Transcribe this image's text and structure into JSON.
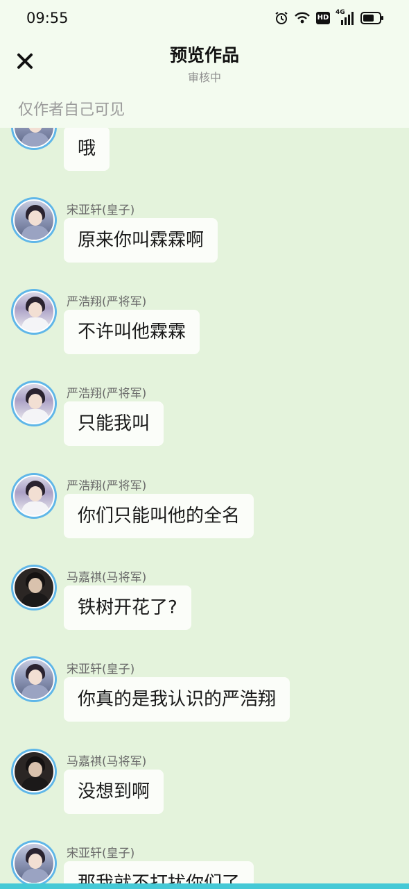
{
  "status_bar": {
    "time": "09:55",
    "icons": [
      "alarm-icon",
      "wifi-icon",
      "hd-icon",
      "4g-signal-icon",
      "battery-icon"
    ],
    "hd_label": "HD",
    "network_label": "4G"
  },
  "header": {
    "close_icon": "close-icon",
    "title": "预览作品",
    "subtitle": "审核中",
    "visibility_note": "仅作者自己可见"
  },
  "messages": [
    {
      "sender": "",
      "text": "哦",
      "avatar": "cool"
    },
    {
      "sender": "宋亚轩(皇子)",
      "text": "原来你叫霖霖啊",
      "avatar": "cool"
    },
    {
      "sender": "严浩翔(严将军)",
      "text": "不许叫他霖霖",
      "avatar": "white"
    },
    {
      "sender": "严浩翔(严将军)",
      "text": "只能我叫",
      "avatar": "white"
    },
    {
      "sender": "严浩翔(严将军)",
      "text": "你们只能叫他的全名",
      "avatar": "white"
    },
    {
      "sender": "马嘉祺(马将军)",
      "text": "铁树开花了?",
      "avatar": "dark"
    },
    {
      "sender": "宋亚轩(皇子)",
      "text": "你真的是我认识的严浩翔",
      "avatar": "cool"
    },
    {
      "sender": "马嘉祺(马将军)",
      "text": "没想到啊",
      "avatar": "dark"
    },
    {
      "sender": "宋亚轩(皇子)",
      "text": "那我就不打扰你们了",
      "avatar": "cool"
    }
  ],
  "colors": {
    "page_background": "#e4f3dc",
    "header_background": "#f3fbef",
    "bubble_background": "#fbfdf9",
    "avatar_ring": "#5fb6e8",
    "bottom_strip": "#45c9d6"
  }
}
